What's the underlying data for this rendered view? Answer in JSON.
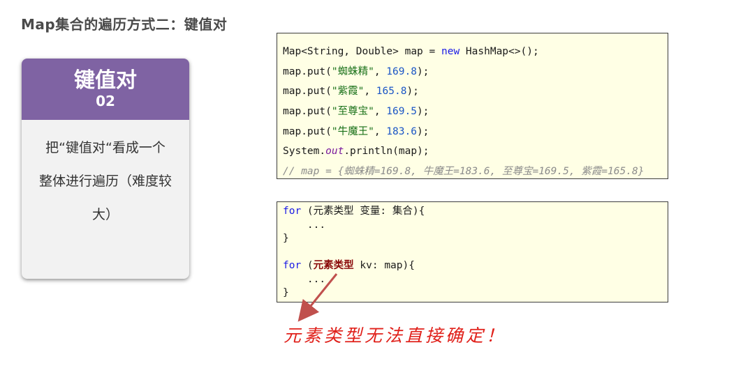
{
  "page": {
    "title": "Map集合的遍历方式二：键值对"
  },
  "card": {
    "heading": "键值对",
    "number": "02",
    "body_lines": [
      "把“键值对“看成一个",
      "整体进行遍历（难度较",
      "大）"
    ]
  },
  "code_block_1": {
    "lines": [
      [
        {
          "t": "Map<String, Double> map = ",
          "c": ""
        },
        {
          "t": "new",
          "c": "kw"
        },
        {
          "t": " HashMap<>();",
          "c": ""
        }
      ],
      [
        {
          "t": "map.put(",
          "c": ""
        },
        {
          "t": "\"蜘蛛精\"",
          "c": "str"
        },
        {
          "t": ", ",
          "c": ""
        },
        {
          "t": "169.8",
          "c": "num"
        },
        {
          "t": ");",
          "c": ""
        }
      ],
      [
        {
          "t": "map.put(",
          "c": ""
        },
        {
          "t": "\"紫霞\"",
          "c": "str"
        },
        {
          "t": ", ",
          "c": ""
        },
        {
          "t": "165.8",
          "c": "num"
        },
        {
          "t": ");",
          "c": ""
        }
      ],
      [
        {
          "t": "map.put(",
          "c": ""
        },
        {
          "t": "\"至尊宝\"",
          "c": "str"
        },
        {
          "t": ", ",
          "c": ""
        },
        {
          "t": "169.5",
          "c": "num"
        },
        {
          "t": ");",
          "c": ""
        }
      ],
      [
        {
          "t": "map.put(",
          "c": ""
        },
        {
          "t": "\"牛魔王\"",
          "c": "str"
        },
        {
          "t": ", ",
          "c": ""
        },
        {
          "t": "183.6",
          "c": "num"
        },
        {
          "t": ");",
          "c": ""
        }
      ],
      [
        {
          "t": "System.",
          "c": ""
        },
        {
          "t": "out",
          "c": "fld"
        },
        {
          "t": ".println(map);",
          "c": ""
        }
      ],
      [
        {
          "t": "// map = {蜘蛛精=169.8, 牛魔王=183.6, 至尊宝=169.5, 紫霞=165.8}",
          "c": "cmt"
        }
      ]
    ]
  },
  "code_block_2": {
    "lines": [
      [
        {
          "t": "for",
          "c": "kw"
        },
        {
          "t": " (元素类型 变量: 集合){",
          "c": ""
        }
      ],
      [
        {
          "t": "    ...",
          "c": ""
        }
      ],
      [
        {
          "t": "}",
          "c": ""
        }
      ],
      [
        {
          "t": "",
          "c": ""
        }
      ],
      [
        {
          "t": "for",
          "c": "kw"
        },
        {
          "t": " (",
          "c": ""
        },
        {
          "t": "元素类型",
          "c": "hl"
        },
        {
          "t": " kv: map){",
          "c": ""
        }
      ],
      [
        {
          "t": "    ...",
          "c": ""
        }
      ],
      [
        {
          "t": "}",
          "c": ""
        }
      ]
    ]
  },
  "annotation": {
    "text": "元素类型无法直接确定！",
    "color": "#e0201a"
  },
  "colors": {
    "card_header": "#7f63a3",
    "code_background": "#ffffe5",
    "keyword": "#1a1ae6",
    "string": "#187018",
    "number": "#1a55c6",
    "comment": "#8c8c8c",
    "arrow": "#c0504d"
  }
}
